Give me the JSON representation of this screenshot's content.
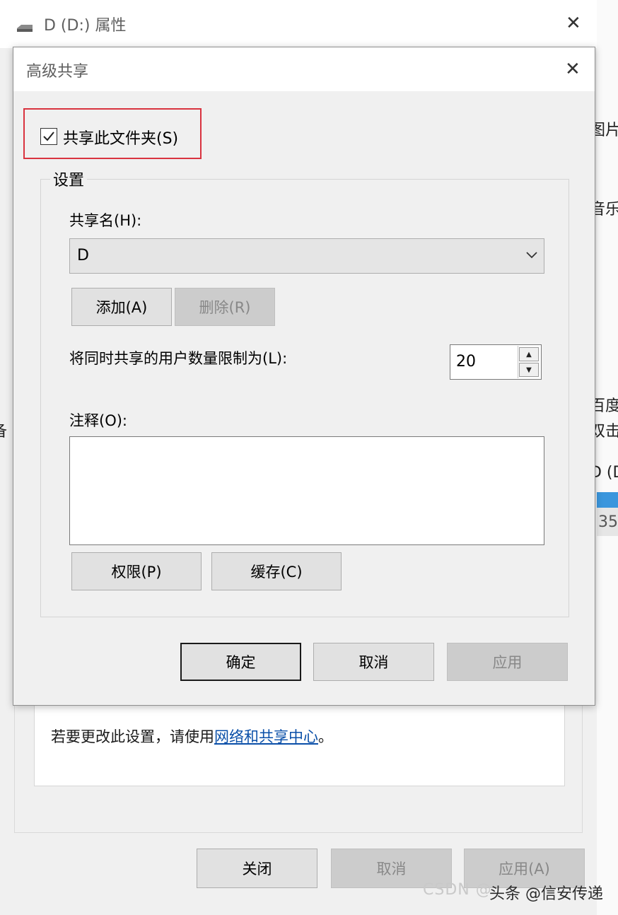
{
  "outer_window": {
    "title": "D (D:) 属性",
    "right_edge_fragments": [
      "图片",
      "音乐",
      "百度",
      "双击",
      "D (D",
      "35"
    ],
    "left_edge_fragment": "备",
    "info_text": "若要更改此设置，请使用",
    "link_text": "网络和共享中心",
    "info_suffix": "。",
    "buttons": {
      "close": "关闭",
      "cancel": "取消",
      "apply": "应用(A)"
    }
  },
  "dialog": {
    "title": "高级共享",
    "share_checkbox": {
      "label": "共享此文件夹(S)",
      "checked": true
    },
    "settings_group": "设置",
    "share_name_label": "共享名(H):",
    "share_name_value": "D",
    "add_button": "添加(A)",
    "remove_button": "删除(R)",
    "limit_label": "将同时共享的用户数量限制为(L):",
    "limit_value": "20",
    "comment_label": "注释(O):",
    "comment_value": "",
    "permissions_button": "权限(P)",
    "caching_button": "缓存(C)",
    "ok_button": "确定",
    "cancel_button": "取消",
    "apply_button": "应用"
  },
  "watermark": {
    "prefix": "CSDN @",
    "text": "头条 @信安传递"
  },
  "colors": {
    "highlight": "#d9333f",
    "link": "#0a4fa8",
    "accent": "#3a96dd"
  }
}
